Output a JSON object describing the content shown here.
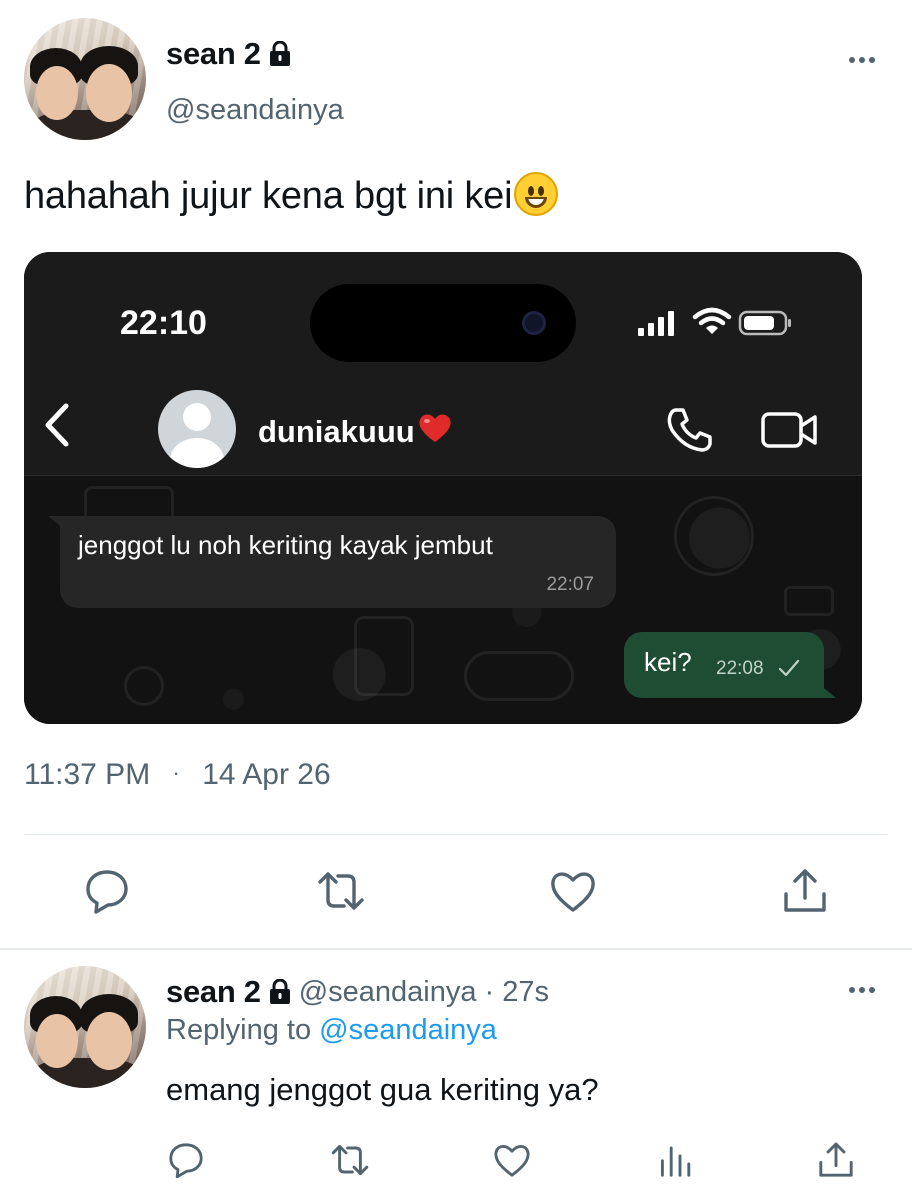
{
  "tweet": {
    "author": {
      "name": "sean 2",
      "handle": "@seandainya"
    },
    "text": "hahahah jujur kena bgt ini kei",
    "timestamp": "11:37 PM",
    "separator": "·",
    "date": "14 Apr 26"
  },
  "screenshot": {
    "status_time": "22:10",
    "contact_name": "duniakuuu",
    "messages": [
      {
        "direction": "incoming",
        "text": "jenggot lu noh keriting kayak jembut",
        "time": "22:07"
      },
      {
        "direction": "outgoing",
        "text": "kei?",
        "time": "22:08"
      }
    ]
  },
  "reply": {
    "author": {
      "name": "sean 2",
      "handle": "@seandainya"
    },
    "age": "· 27s",
    "replying_prefix": "Replying to",
    "replying_to": "@seandainya",
    "text": "emang jenggot gua keriting ya?"
  },
  "icons": {
    "lock": "lock-icon",
    "more": "more-horizontal-icon",
    "reply": "comment-bubble-icon",
    "retweet": "retweet-icon",
    "like": "heart-icon",
    "share": "share-upload-icon",
    "views": "analytics-bar-icon"
  },
  "colors": {
    "text_primary": "#0f1419",
    "text_secondary": "#536471",
    "link": "#1d9bf0",
    "wa_outgoing_bubble": "#1e4d34",
    "wa_incoming_bubble": "#262626"
  }
}
